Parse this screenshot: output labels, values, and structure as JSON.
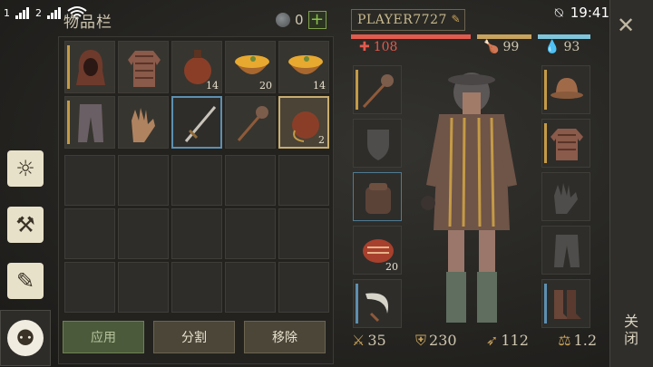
{
  "status": {
    "time": "19:41",
    "sim1": "1",
    "sim2": "2"
  },
  "inventory": {
    "title": "物品栏",
    "coins": "0",
    "top_slots": [
      {
        "item": "hood",
        "qty": ""
      },
      {
        "item": "chainmail-shirt",
        "qty": ""
      },
      {
        "item": "leather-flask",
        "qty": "14"
      },
      {
        "item": "soup-bowl",
        "qty": "20"
      },
      {
        "item": "soup-bowl",
        "qty": "14"
      },
      {
        "item": "cloth-pants",
        "qty": ""
      },
      {
        "item": "leather-gloves",
        "qty": ""
      },
      {
        "item": "sword",
        "qty": ""
      },
      {
        "item": "mace",
        "qty": ""
      },
      {
        "item": "leather-flask-selected",
        "qty": "2"
      }
    ],
    "buttons": {
      "apply": "应用",
      "split": "分割",
      "remove": "移除"
    }
  },
  "character": {
    "name": "PLAYER7727",
    "hp": "108",
    "food": "99",
    "water": "93",
    "left_slots": [
      {
        "item": "mace",
        "qty": ""
      },
      {
        "item": "shield-empty",
        "qty": ""
      },
      {
        "item": "backpack",
        "qty": ""
      },
      {
        "item": "raw-meat",
        "qty": "20"
      },
      {
        "item": "sickle",
        "qty": ""
      }
    ],
    "right_slots": [
      {
        "item": "kettle-helmet",
        "qty": ""
      },
      {
        "item": "chainmail-shirt",
        "qty": ""
      },
      {
        "item": "gloves-empty",
        "qty": ""
      },
      {
        "item": "pants-empty",
        "qty": ""
      },
      {
        "item": "boots",
        "qty": ""
      }
    ],
    "stats": {
      "attack": "35",
      "armor": "230",
      "speed": "112",
      "weight": "1.2"
    }
  },
  "close": {
    "label": "关闭"
  },
  "colors": {
    "hp": "#e35a4d",
    "food": "#c8a35d",
    "water": "#7ec5dc",
    "accent": "#c49a45"
  }
}
